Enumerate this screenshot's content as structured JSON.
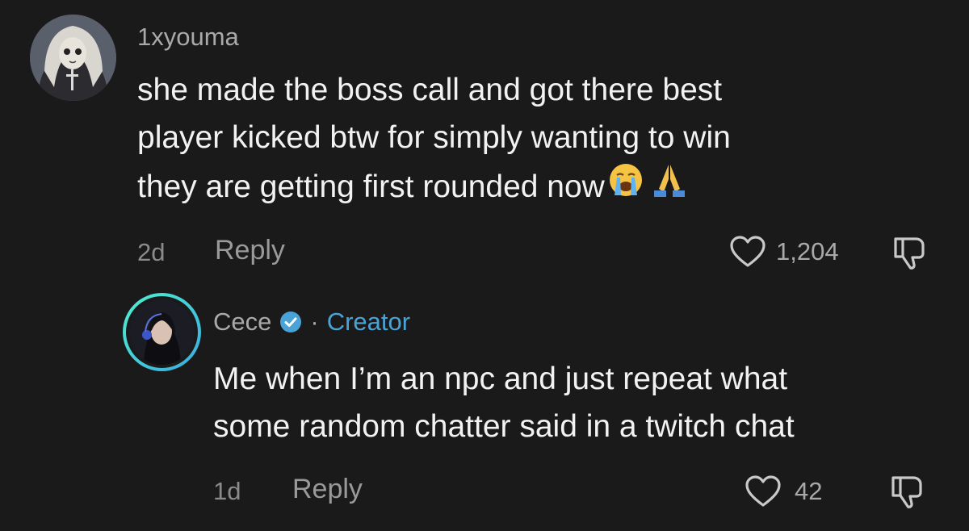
{
  "comment_1": {
    "username": "1xyouma",
    "lines": [
      "she made the boss call and got there best",
      "player kicked btw for simply wanting to win",
      "they are getting first rounded now"
    ],
    "emojis": [
      "loudly-crying-face",
      "folded-hands"
    ],
    "time": "2d",
    "reply_label": "Reply",
    "like_count": "1,204"
  },
  "comment_2": {
    "username": "Cece",
    "separator": "·",
    "badge_label": "Creator",
    "lines": [
      "Me when I’m an npc and just repeat what",
      "some random chatter said in a twitch chat"
    ],
    "time": "1d",
    "reply_label": "Reply",
    "like_count": "42"
  },
  "colors": {
    "background": "#1a1a1a",
    "creator_accent": "#4aa3d6",
    "verified_badge": "#4aa3d6"
  }
}
